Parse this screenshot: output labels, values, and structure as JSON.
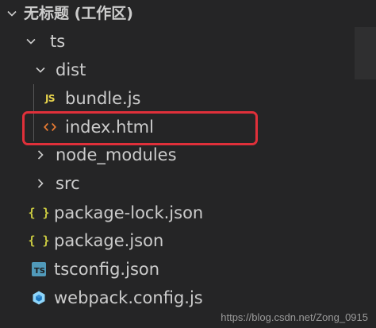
{
  "workspace": {
    "title": "无标题 (工作区)"
  },
  "tree": {
    "ts": "ts",
    "dist": "dist",
    "bundle": "bundle.js",
    "index": "index.html",
    "node_modules": "node_modules",
    "src": "src",
    "package_lock": "package-lock.json",
    "package": "package.json",
    "tsconfig": "tsconfig.json",
    "webpack": "webpack.config.js"
  },
  "icons": {
    "js_badge": "JS",
    "json_badge": "{ }",
    "ts_badge": "TS"
  },
  "colors": {
    "background": "#252526",
    "text": "#cccccc",
    "highlight_border": "#e0303a",
    "js": "#e8d44d",
    "html": "#e37933",
    "json": "#cbcb41",
    "ts": "#519aba",
    "webpack": "#8ed6fb"
  },
  "watermark": "https://blog.csdn.net/Zong_0915"
}
